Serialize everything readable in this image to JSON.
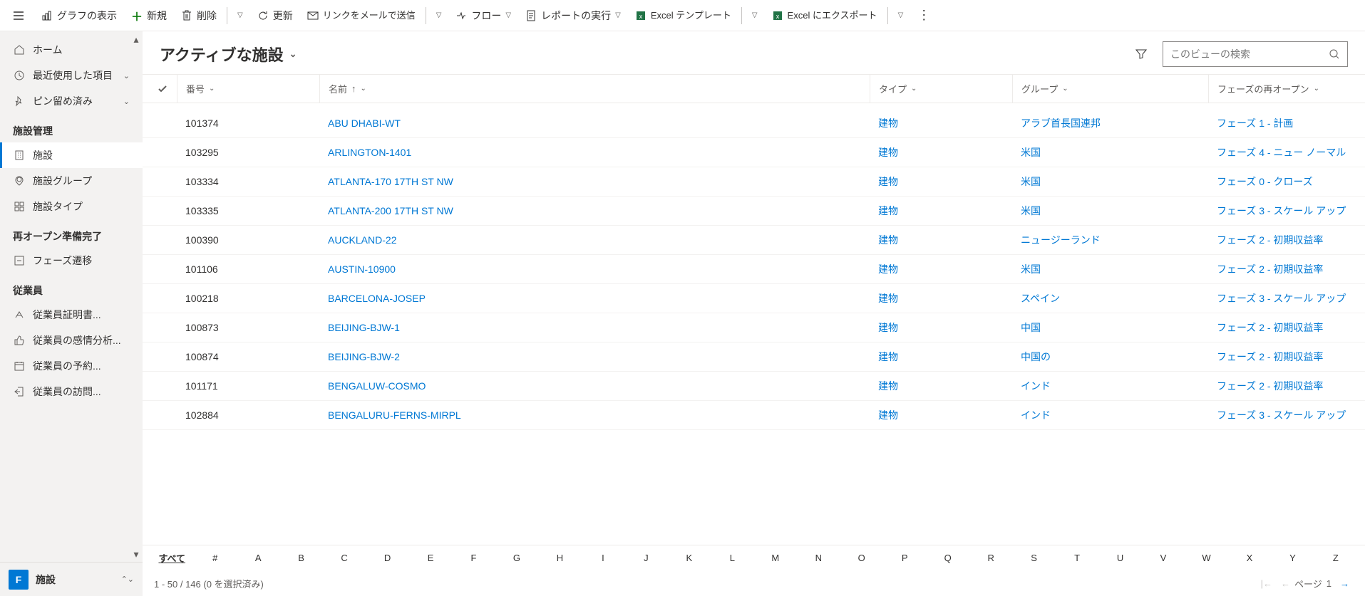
{
  "toolbar": {
    "show_chart": "グラフの表示",
    "new": "新規",
    "delete": "削除",
    "refresh": "更新",
    "send_link": "リンクをメールで送信",
    "flow": "フロー",
    "run_report": "レポートの実行",
    "excel_template": "Excel テンプレート",
    "excel_export": "Excel にエクスポート"
  },
  "sidebar": {
    "home": "ホーム",
    "recent": "最近使用した項目",
    "pinned": "ピン留め済み",
    "section1": "施設管理",
    "facility": "施設",
    "facility_group": "施設グループ",
    "facility_type": "施設タイプ",
    "section2": "再オープン準備完了",
    "phase_transition": "フェーズ遷移",
    "section3": "従業員",
    "emp_cert": "従業員証明書...",
    "emp_sentiment": "従業員の感情分析...",
    "emp_booking": "従業員の予約...",
    "emp_visit": "従業員の訪問...",
    "footer_tile": "F",
    "footer_label": "施設"
  },
  "view": {
    "title": "アクティブな施設",
    "search_placeholder": "このビューの検索"
  },
  "columns": {
    "number": "番号",
    "name": "名前",
    "type": "タイプ",
    "group": "グループ",
    "phase": "フェーズの再オープン"
  },
  "rows": [
    {
      "num": "101374",
      "name": "ABU DHABI-WT",
      "type": "建物",
      "group": "アラブ首長国連邦",
      "phase": "フェーズ 1 - 計画"
    },
    {
      "num": "103295",
      "name": "ARLINGTON-1401",
      "type": "建物",
      "group": "米国",
      "phase": "フェーズ 4 - ニュー ノーマル"
    },
    {
      "num": "103334",
      "name": "ATLANTA-170 17TH ST NW",
      "type": "建物",
      "group": "米国",
      "phase": "フェーズ 0 - クローズ"
    },
    {
      "num": "103335",
      "name": "ATLANTA-200 17TH ST NW",
      "type": "建物",
      "group": "米国",
      "phase": "フェーズ 3 - スケール アップ"
    },
    {
      "num": "100390",
      "name": "AUCKLAND-22",
      "type": "建物",
      "group": "ニュージーランド",
      "phase": "フェーズ 2 - 初期収益率"
    },
    {
      "num": "101106",
      "name": "AUSTIN-10900",
      "type": "建物",
      "group": "米国",
      "phase": "フェーズ 2 - 初期収益率"
    },
    {
      "num": "100218",
      "name": "BARCELONA-JOSEP",
      "type": "建物",
      "group": "スペイン",
      "phase": "フェーズ 3 - スケール アップ"
    },
    {
      "num": "100873",
      "name": "BEIJING-BJW-1",
      "type": "建物",
      "group": "中国",
      "phase": "フェーズ 2 - 初期収益率"
    },
    {
      "num": "100874",
      "name": "BEIJING-BJW-2",
      "type": "建物",
      "group": "中国の",
      "phase": "フェーズ 2 - 初期収益率"
    },
    {
      "num": "101171",
      "name": "BENGALUW-COSMO",
      "type": "建物",
      "group": "インド",
      "phase": "フェーズ 2 - 初期収益率"
    },
    {
      "num": "102884",
      "name": "BENGALURU-FERNS-MIRPL",
      "type": "建物",
      "group": "インド",
      "phase": "フェーズ 3 - スケール アップ"
    }
  ],
  "alpha": {
    "all": "すべて",
    "hash": "#",
    "letters": [
      "A",
      "B",
      "C",
      "D",
      "E",
      "F",
      "G",
      "H",
      "I",
      "J",
      "K",
      "L",
      "M",
      "N",
      "O",
      "P",
      "Q",
      "R",
      "S",
      "T",
      "U",
      "V",
      "W",
      "X",
      "Y",
      "Z"
    ]
  },
  "status": {
    "range": "1 - 50 / 146 (0 を選択済み)",
    "page_label": "ページ",
    "page_num": "1"
  }
}
